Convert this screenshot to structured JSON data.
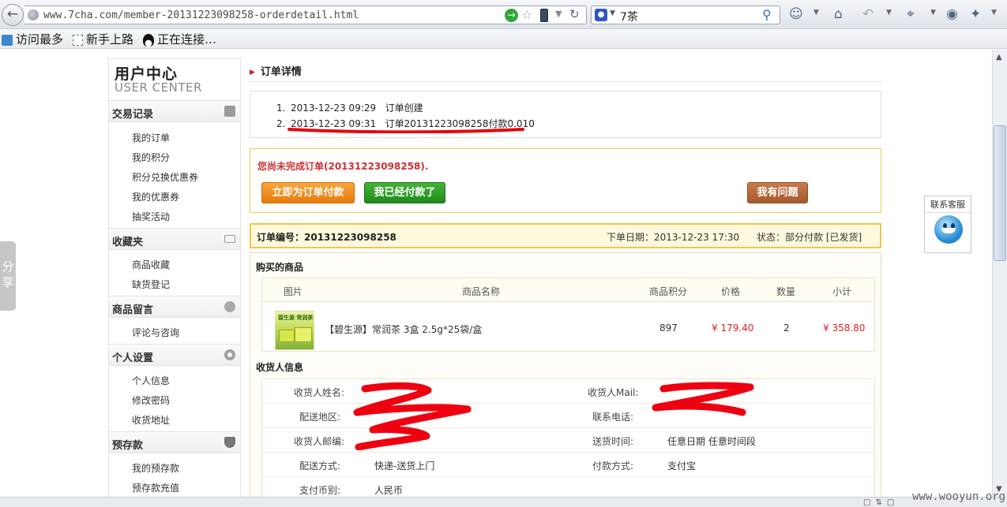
{
  "browser": {
    "url": "www.7cha.com/member-20131223098258-orderdetail.html",
    "search_query": "7茶",
    "bookmarks": [
      "访问最多",
      "新手上路",
      "正在连接…"
    ]
  },
  "share_tab": "分享",
  "sidebar": {
    "title": "用户中心",
    "subtitle": "USER CENTER",
    "sections": [
      {
        "label": "交易记录",
        "items": [
          "我的订单",
          "我的积分",
          "积分兑换优惠券",
          "我的优惠券",
          "抽奖活动"
        ]
      },
      {
        "label": "收藏夹",
        "items": [
          "商品收藏",
          "缺货登记"
        ]
      },
      {
        "label": "商品留言",
        "items": [
          "评论与咨询"
        ]
      },
      {
        "label": "个人设置",
        "items": [
          "个人信息",
          "修改密码",
          "收货地址"
        ]
      },
      {
        "label": "预存款",
        "items": [
          "我的预存款",
          "预存款充值"
        ]
      }
    ]
  },
  "main": {
    "title": "订单详情",
    "log": [
      {
        "num": "1.",
        "time": "2013-12-23 09:29",
        "text": "订单创建"
      },
      {
        "num": "2.",
        "time": "2013-12-23 09:31",
        "text": "订单20131223098258付款0.010"
      }
    ],
    "notice": "您尚未完成订单(20131223098258).",
    "buttons": {
      "pay": "立即为订单付款",
      "paid": "我已经付款了",
      "question": "我有问题"
    },
    "order_no": "订单编号：20131223098258",
    "order_date": "下单日期：2013-12-23 17:30",
    "order_status": "状态：部分付款 [已发货]",
    "goods_heading": "购买的商品",
    "goods_columns": [
      "图片",
      "商品名称",
      "商品积分",
      "价格",
      "数量",
      "小计"
    ],
    "goods_row": {
      "name": "【碧生源】常润茶 3盒 2.5g*25袋/盒",
      "points": "897",
      "price": "¥ 179.40",
      "qty": "2",
      "subtotal": "¥ 358.80",
      "image_label": "碧生源 常润茶"
    },
    "receiver_heading": "收货人信息",
    "receiver": {
      "name_label": "收货人姓名:",
      "mail_label": "收货人Mail:",
      "area_label": "配送地区:",
      "phone_label": "联系电话:",
      "zip_label": "收货人邮编:",
      "time_label": "送货时间:",
      "time_value": "任意日期 任意时间段",
      "ship_label": "配送方式:",
      "ship_value": "快递-送货上门",
      "pay_label": "付款方式:",
      "pay_value": "支付宝",
      "currency_label": "支付币别:",
      "currency_value": "人民币"
    }
  },
  "contact_widget": "联系客服",
  "watermark": "www.wooyun.org"
}
